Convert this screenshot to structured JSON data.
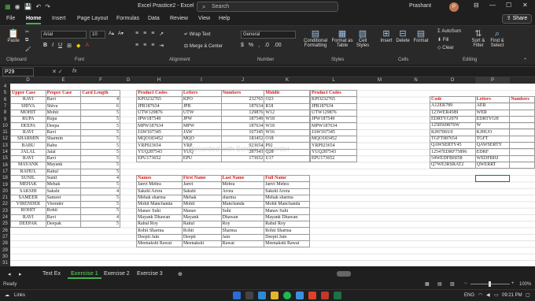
{
  "window": {
    "title": "Excel Prastice2 - Excel",
    "search_placeholder": "Search",
    "user": "Prashant",
    "avatar_initial": "P",
    "minimize": "—",
    "maximize": "☐",
    "close": "✕"
  },
  "menu": {
    "tabs": [
      "File",
      "Home",
      "Insert",
      "Page Layout",
      "Formulas",
      "Data",
      "Review",
      "View",
      "Help"
    ],
    "active": "Home",
    "share": "Share"
  },
  "ribbon": {
    "paste": "Paste",
    "clipboard": "Clipboard",
    "font_name": "Arial",
    "font_size": "10",
    "font_group": "Font",
    "wrap_text": "Wrap Text",
    "merge_center": "Merge & Center",
    "alignment": "Alignment",
    "number_format": "General",
    "number": "Number",
    "conditional": "Conditional Formatting",
    "format_table": "Format as Table",
    "cell_styles": "Cell Styles",
    "styles": "Styles",
    "insert": "Insert",
    "delete": "Delete",
    "format": "Format",
    "cells": "Cells",
    "autosum": "AutoSum",
    "fill": "Fill",
    "clear": "Clear",
    "sort_filter": "Sort & Filter",
    "find_select": "Find & Select",
    "editing": "Editing"
  },
  "formula_bar": {
    "name_box": "P29",
    "fx": "fx",
    "value": ""
  },
  "columns": [
    "D",
    "E",
    "F",
    "G",
    "H",
    "I",
    "J",
    "K",
    "L",
    "M",
    "N",
    "O",
    "P"
  ],
  "rows": [
    "4",
    "5",
    "6",
    "7",
    "8",
    "9",
    "10",
    "11",
    "12",
    "13",
    "14",
    "15",
    "16",
    "17",
    "18",
    "19",
    "20",
    "21",
    "22",
    "23",
    "24",
    "25",
    "26",
    "27",
    "28",
    "29",
    "30",
    "31"
  ],
  "table1": {
    "headers": [
      "Upper Case",
      "Proper Case",
      "Card Length"
    ],
    "rows": [
      [
        "RAVI",
        "Ravi",
        "4"
      ],
      [
        "SHIVA",
        "Shiva",
        "6"
      ],
      [
        "MOHIT",
        "Mohit",
        "5"
      ],
      [
        "RUPA",
        "Rupa",
        "5"
      ],
      [
        "DEEPA",
        "Deepa",
        "5"
      ],
      [
        "RAVI",
        "Ravi",
        "5"
      ],
      [
        "SHARMIN",
        "Sharmin",
        "5"
      ],
      [
        "BABU",
        "Babu",
        "5"
      ],
      [
        "JALAL",
        "Jalal",
        "5"
      ],
      [
        "RAVI",
        "Ravi",
        "5"
      ],
      [
        "MAYANK",
        "Mayank",
        "5"
      ],
      [
        "RAHUL",
        "Rahul",
        "5"
      ],
      [
        "SUNIL",
        "Sunil",
        "4"
      ],
      [
        "MEHAK",
        "Mehak",
        "5"
      ],
      [
        "SAKSHI",
        "Sakshi",
        "4"
      ],
      [
        "SAMEER",
        "Sameer",
        "5"
      ],
      [
        "VIRENDER",
        "Virender",
        "5"
      ],
      [
        "ROHIT",
        "Rohit",
        "5"
      ],
      [
        "RAVI",
        "Ravi",
        "4"
      ],
      [
        "DEEPAK",
        "Deepak",
        "5"
      ]
    ]
  },
  "table2": {
    "headers": [
      "Product Codes",
      "Letters",
      "Numbers",
      "Middle"
    ],
    "rows": [
      [
        "KPO232765",
        "KPO",
        "232765",
        "O23"
      ],
      [
        "JPR187634",
        "JPR",
        "187634",
        "R18"
      ],
      [
        "UTW129876",
        "UTW",
        "129876",
        "W12"
      ],
      [
        "JPW187549",
        "JPW",
        "187549",
        "W18"
      ],
      [
        "MPW187634",
        "MPW",
        "187634",
        "W18"
      ],
      [
        "JAW167345",
        "JAW",
        "167345",
        "W16"
      ],
      [
        "MQO183452",
        "MQO",
        "183452",
        "O18"
      ],
      [
        "YRP923654",
        "YRP",
        "923654",
        "P92"
      ],
      [
        "YUQ287543",
        "YUQ",
        "287543",
        "Q28"
      ],
      [
        "EPU173652",
        "EPU",
        "173652",
        "U17"
      ]
    ]
  },
  "table3": {
    "headers": [
      "Product Codes"
    ],
    "rows": [
      "KPO232765",
      "JPR187634",
      "UTW129876",
      "JPW187549",
      "MPW187634",
      "JAW167345",
      "MQO183452",
      "YRP923654",
      "YUQ287543",
      "EPU173652"
    ]
  },
  "table4": {
    "headers": [
      "Names",
      "First Name",
      "Last Name",
      "Full Name"
    ],
    "rows": [
      [
        "Janvi Mehra",
        "Janvi",
        "Mehra",
        "Janvi Mehra"
      ],
      [
        "Sakshi Arora",
        "Sakshi",
        "Arora",
        "Sakshi Arora"
      ],
      [
        "Mehak sharma",
        "Mehak",
        "sharma",
        "Mehak sharma"
      ],
      [
        "Mohit Manchanda",
        "Mohit",
        "Manchanda",
        "Mohit Manchanda"
      ],
      [
        "Manav Suhi",
        "Manav",
        "Suhi",
        "Manav Suhi"
      ],
      [
        "Mayank Dhawan",
        "Mayank",
        "Dhawan",
        "Mayank Dhawan"
      ],
      [
        "Rahul Roy",
        "Rahul",
        "Roy",
        "Rahul Roy"
      ],
      [
        "Rohit Sharma",
        "Rohit",
        "Sharma",
        "Rohit Sharma"
      ],
      [
        "Deepti Jain",
        "Deepti",
        "Jain",
        "Deepti Jain"
      ],
      [
        "Meenakshi Rawat",
        "Meenakshi",
        "Rawat",
        "Meenakshi Rawat"
      ]
    ]
  },
  "table5": {
    "headers": [
      "Code",
      "Letters",
      "Numbers"
    ],
    "rows": [
      [
        "A12ER789",
        "AER"
      ],
      [
        "123WER4589",
        "WER"
      ],
      [
        "EDRTYGH79",
        "EDRTYGH"
      ],
      [
        "125856987SW",
        "W"
      ],
      [
        "KJH78SU0",
        "KJHUO"
      ],
      [
        "TGFT987654",
        "TGFT"
      ],
      [
        "QAWSERTY45",
        "QAWSERTY"
      ],
      [
        "12547EDRF75896",
        "EDRF"
      ],
      [
        "54WEDFBHJ58",
        "WEDFBHJ"
      ],
      [
        "Q7WE3RSRAT2",
        "QWERRT"
      ]
    ]
  },
  "watermark": "Recorded with Screen Recorder",
  "sheet_tabs": [
    "Text Ex",
    "Exercise 1",
    "Exercise 2",
    "Exercise 3"
  ],
  "active_sheet": "Exercise 1",
  "status": {
    "ready": "Ready",
    "zoom": "100%"
  },
  "taskbar": {
    "links": "Links",
    "lang": "ENG",
    "time": "09:21 PM"
  }
}
